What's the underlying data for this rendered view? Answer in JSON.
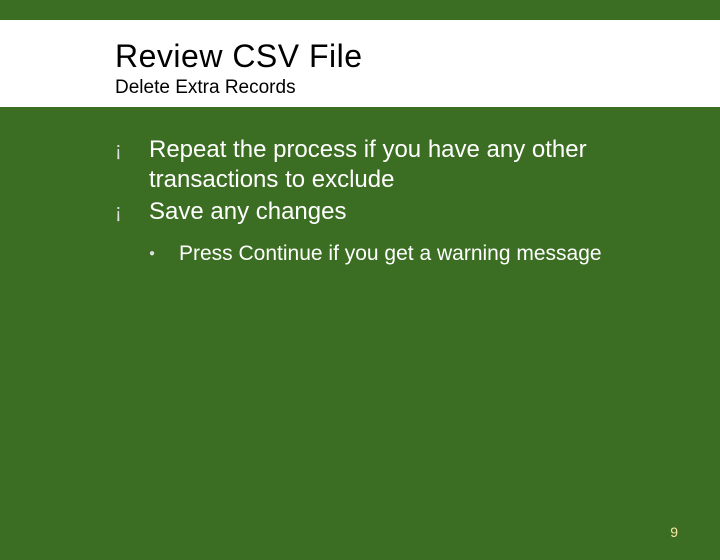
{
  "header": {
    "title": "Review CSV File",
    "subtitle": "Delete Extra Records"
  },
  "bullets": [
    {
      "mark": "¡",
      "text": "Repeat the process if you have any other transactions to exclude"
    },
    {
      "mark": "¡",
      "text": "Save any changes"
    }
  ],
  "subbullets": [
    {
      "mark": "●",
      "text": "Press Continue if you get a warning message"
    }
  ],
  "page_number": "9"
}
